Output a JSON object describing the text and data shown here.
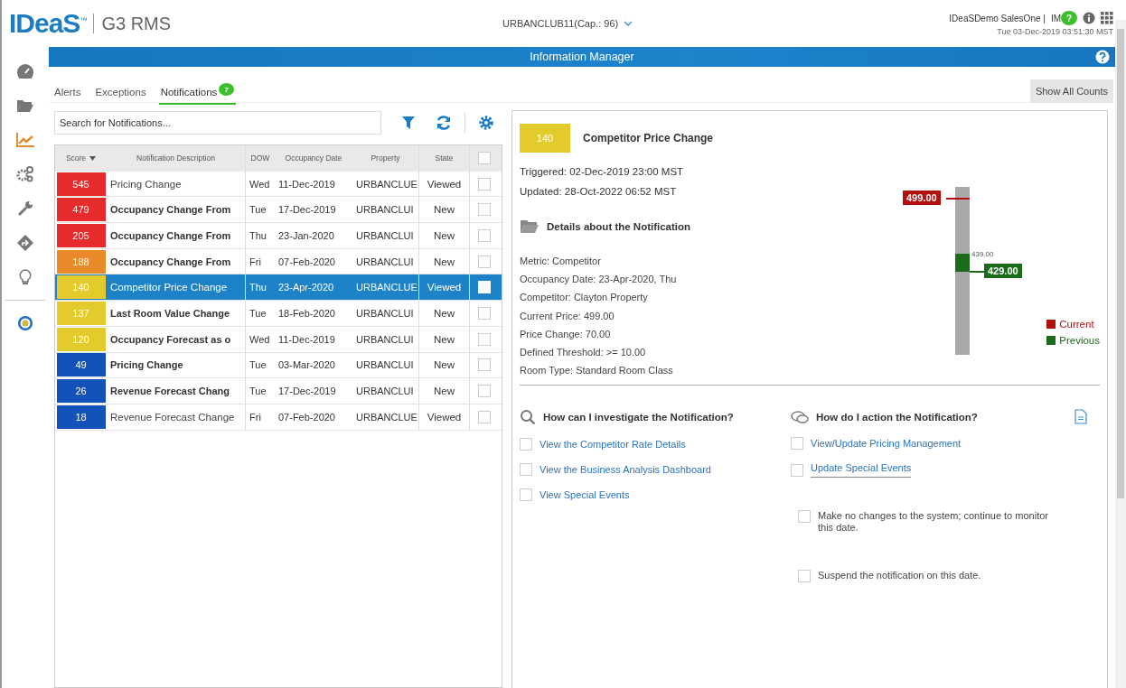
{
  "header": {
    "logo": "IDeaS",
    "logo_mark": "™",
    "product": "G3 RMS",
    "property": "URBANCLUB11(Cap.: 96)",
    "user": "IDeaSDemo SalesOne |",
    "initials": "IM",
    "chat_badge": "?",
    "datetime": "Tue 03-Dec-2019 03:51:30 MST"
  },
  "title_bar": {
    "title": "Information Manager"
  },
  "sidebar": {
    "items": [
      {
        "kind": "gauge",
        "selected": false
      },
      {
        "kind": "folder",
        "selected": false
      },
      {
        "kind": "chart",
        "selected": true
      },
      {
        "kind": "gears",
        "selected": false
      },
      {
        "kind": "wrench",
        "selected": false
      },
      {
        "kind": "diamond",
        "selected": false
      },
      {
        "kind": "bulb",
        "selected": false
      },
      {
        "kind": "globe",
        "selected": false
      }
    ]
  },
  "tabs": [
    {
      "label": "Alerts",
      "selected": false
    },
    {
      "label": "Exceptions",
      "selected": false
    },
    {
      "label": "Notifications",
      "selected": true,
      "badge": "7"
    }
  ],
  "show_all_counts": "Show All Counts",
  "search": {
    "placeholder": "Search for Notifications..."
  },
  "table": {
    "columns": [
      "Score",
      "Notification Description",
      "DOW",
      "Occupancy Date",
      "Property",
      "State"
    ],
    "select_all_checked": false,
    "rows": [
      {
        "score": "545",
        "color": "#e52b2b",
        "description": "Pricing Change",
        "dow": "Wed",
        "date": "11-Dec-2019",
        "property": "URBANCLUE",
        "state": "Viewed",
        "unread": false,
        "selected": false,
        "checked": false
      },
      {
        "score": "479",
        "color": "#e52b2b",
        "description": "Occupancy Change From",
        "dow": "Tue",
        "date": "17-Dec-2019",
        "property": "URBANCLUI",
        "state": "New",
        "unread": true,
        "selected": false,
        "checked": false
      },
      {
        "score": "205",
        "color": "#e52b2b",
        "description": "Occupancy Change From",
        "dow": "Thu",
        "date": "23-Jan-2020",
        "property": "URBANCLUI",
        "state": "New",
        "unread": true,
        "selected": false,
        "checked": false
      },
      {
        "score": "188",
        "color": "#e8892a",
        "description": "Occupancy Change From",
        "dow": "Fri",
        "date": "07-Feb-2020",
        "property": "URBANCLUI",
        "state": "New",
        "unread": true,
        "selected": false,
        "checked": false
      },
      {
        "score": "140",
        "color": "#e3cb2c",
        "description": "Competitor Price Change",
        "dow": "Thu",
        "date": "23-Apr-2020",
        "property": "URBANCLUE",
        "state": "Viewed",
        "unread": false,
        "selected": true,
        "checked": false
      },
      {
        "score": "137",
        "color": "#e3cb2c",
        "description": "Last Room Value Change",
        "dow": "Tue",
        "date": "18-Feb-2020",
        "property": "URBANCLUI",
        "state": "New",
        "unread": true,
        "selected": false,
        "checked": false
      },
      {
        "score": "120",
        "color": "#e3cb2c",
        "description": "Occupancy Forecast as o",
        "dow": "Wed",
        "date": "11-Dec-2019",
        "property": "URBANCLUI",
        "state": "New",
        "unread": true,
        "selected": false,
        "checked": false
      },
      {
        "score": "49",
        "color": "#1352b8",
        "description": "Pricing Change",
        "dow": "Tue",
        "date": "03-Mar-2020",
        "property": "URBANCLUI",
        "state": "New",
        "unread": true,
        "selected": false,
        "checked": false
      },
      {
        "score": "26",
        "color": "#1352b8",
        "description": "Revenue Forecast Chang",
        "dow": "Tue",
        "date": "17-Dec-2019",
        "property": "URBANCLUI",
        "state": "New",
        "unread": true,
        "selected": false,
        "checked": false
      },
      {
        "score": "18",
        "color": "#1352b8",
        "description": "Revenue Forecast Change",
        "dow": "Fri",
        "date": "07-Feb-2020",
        "property": "URBANCLUE",
        "state": "Viewed",
        "unread": false,
        "selected": false,
        "checked": false
      }
    ]
  },
  "detail": {
    "score": "140",
    "color": "#e3cb2c",
    "title": "Competitor Price Change",
    "triggered": "Triggered: 02-Dec-2019 23:00 MST",
    "updated": "Updated: 28-Oct-2022 06:52 MST",
    "details_heading": "Details about the Notification",
    "details": [
      "Metric: Competitor",
      "Occupancy Date: 23-Apr-2020, Thu",
      "Competitor: Clayton Property",
      "Current Price: 499.00",
      "Price Change: 70.00",
      "Defined Threshold: >= 10.00",
      "Room Type: Standard Room Class"
    ],
    "gauge": {
      "current_label": "499.00",
      "previous_label": "429.00",
      "mid_label": "439.00",
      "legend": [
        {
          "label": "Current",
          "color": "#b30f0f"
        },
        {
          "label": "Previous",
          "color": "#1a6b1a"
        }
      ]
    },
    "investigate": {
      "heading": "How can I investigate the Notification?",
      "links": [
        {
          "label": "View the Competitor Rate Details",
          "checked": false
        },
        {
          "label": "View the Business Analysis Dashboard",
          "checked": false
        },
        {
          "label": "View Special Events",
          "checked": false
        }
      ]
    },
    "action": {
      "heading": "How do I action the Notification?",
      "links": [
        {
          "label": "View/Update Pricing Management",
          "checked": false
        },
        {
          "label": "Update Special Events",
          "checked": false
        }
      ],
      "options": [
        {
          "label": "Make no changes to the system; continue to monitor this date.",
          "checked": false
        },
        {
          "label": "Suspend the notification on this date.",
          "checked": false
        }
      ]
    }
  }
}
